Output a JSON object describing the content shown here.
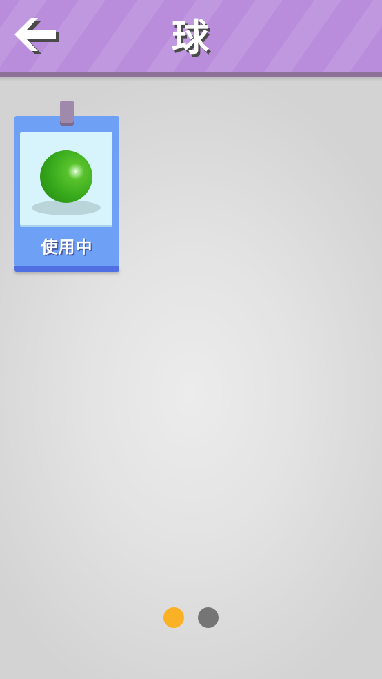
{
  "header": {
    "title": "球",
    "back_icon": "back-arrow-icon",
    "colors": {
      "background": "#b98cdc",
      "shadow": "#8d7196"
    }
  },
  "items": [
    {
      "status_label": "使用中",
      "preview": "green-ball",
      "colors": {
        "card": "#6ea0f6",
        "ball": "#36a81c"
      }
    }
  ],
  "pagination": {
    "total_pages": 2,
    "current_page": 1,
    "colors": {
      "active": "#fbb126",
      "inactive": "#757575"
    }
  }
}
